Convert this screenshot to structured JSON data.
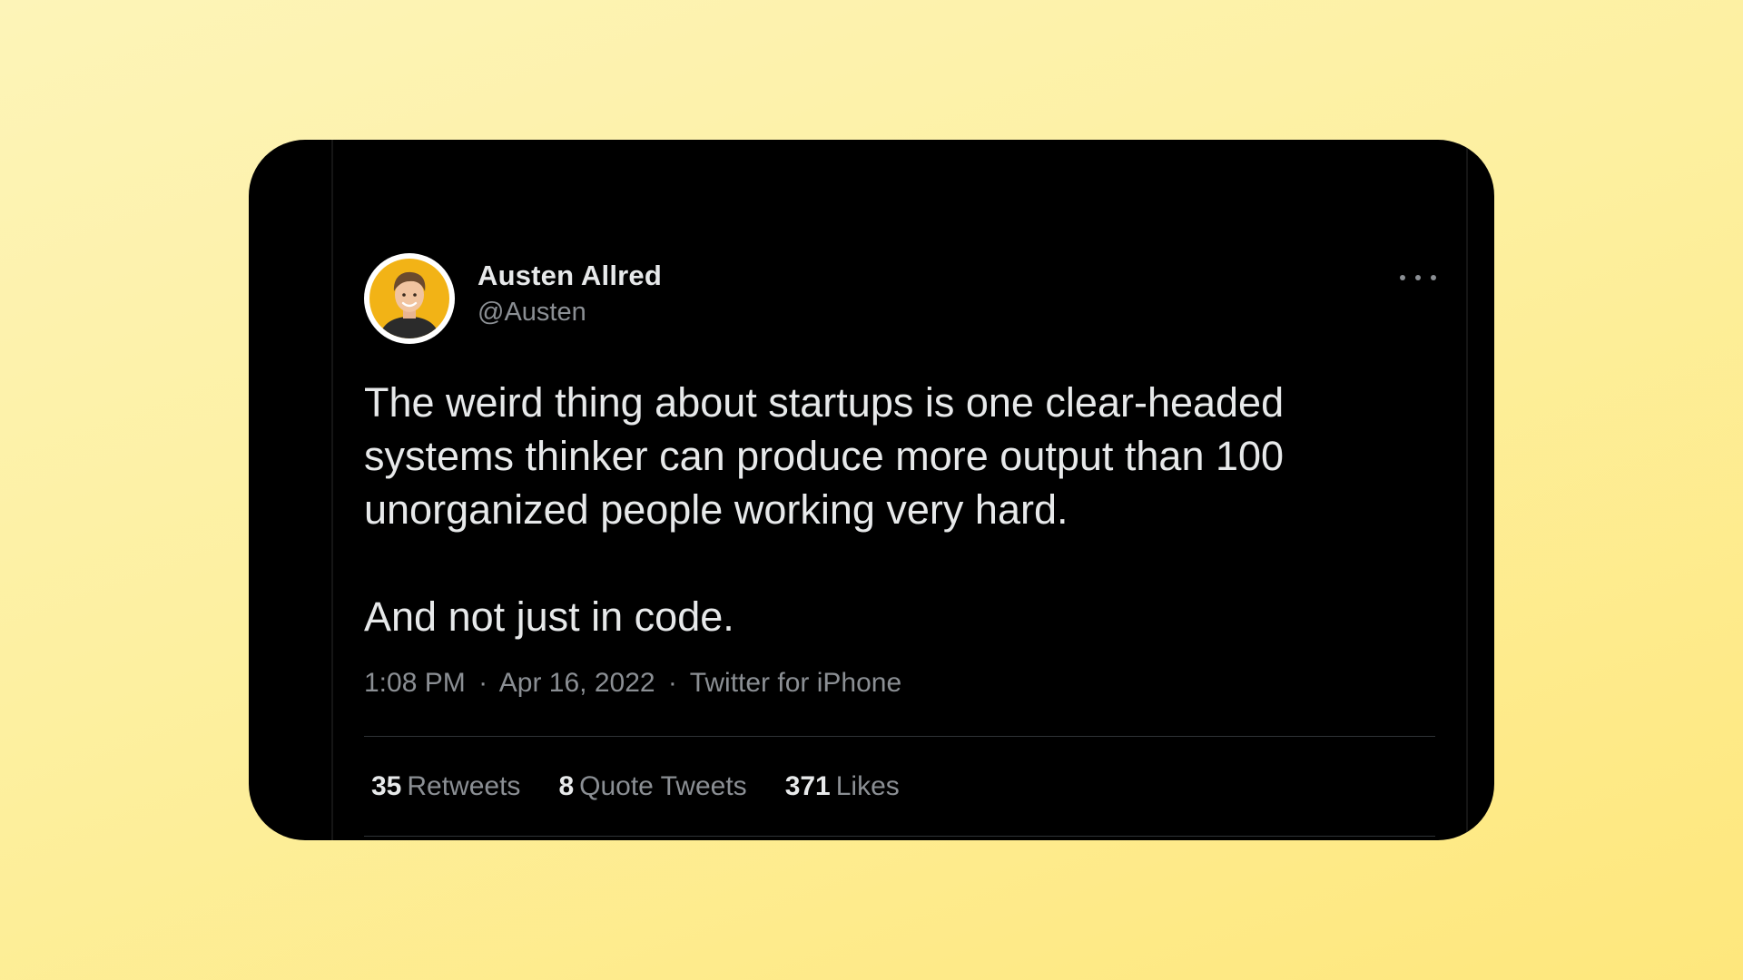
{
  "author": {
    "display_name": "Austen Allred",
    "handle": "@Austen",
    "avatar_icon": "profile-avatar"
  },
  "tweet": {
    "paragraphs": [
      "The weird thing about startups is one clear-headed systems thinker can produce more output than 100 unorganized people working very hard.",
      "And not just in code."
    ],
    "time": "1:08 PM",
    "date": "Apr 16, 2022",
    "source": "Twitter for iPhone",
    "separator": "·"
  },
  "stats": {
    "retweets": {
      "count": "35",
      "label": "Retweets"
    },
    "quote_tweets": {
      "count": "8",
      "label": "Quote Tweets"
    },
    "likes": {
      "count": "371",
      "label": "Likes"
    }
  },
  "colors": {
    "background_top": "#fdf4b8",
    "background_bottom": "#fee77c",
    "card": "#000000",
    "primary_text": "#e7e9ea",
    "secondary_text": "#8b8f94",
    "avatar_bg": "#f2b316"
  }
}
